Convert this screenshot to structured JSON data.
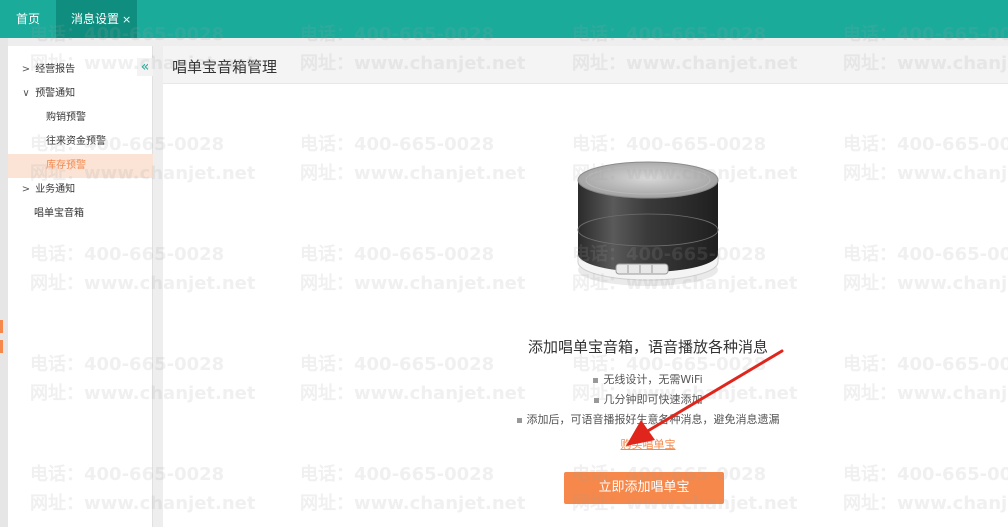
{
  "tabs": {
    "home": "首页",
    "message_settings": "消息设置",
    "close": "×"
  },
  "sidebar": {
    "collapse_icon": "«",
    "items": [
      {
        "label": "经营报告",
        "arrow": ">"
      },
      {
        "label": "预警通知",
        "arrow": "∨"
      },
      {
        "label": "购销预警"
      },
      {
        "label": "往来资金预警"
      },
      {
        "label": "库存预警"
      },
      {
        "label": "业务通知",
        "arrow": ">"
      },
      {
        "label": "唱单宝音箱"
      }
    ]
  },
  "page": {
    "title": "唱单宝音箱管理",
    "headline": "添加唱单宝音箱，语音播放各种消息",
    "features": [
      "无线设计，无需WiFi",
      "几分钟即可快速添加",
      "添加后，可语音播报好生意各种消息，避免消息遗漏"
    ],
    "buy_link": "购买唱单宝",
    "add_button": "立即添加唱单宝"
  },
  "watermark": {
    "phone": "电话：400-665-0028",
    "site": "网址：www.chanjet.net"
  },
  "colors": {
    "topbar": "#1aab9a",
    "active_tab": "#0f8d7e",
    "accent": "#f5884a",
    "annotation_arrow": "#e0261c"
  }
}
